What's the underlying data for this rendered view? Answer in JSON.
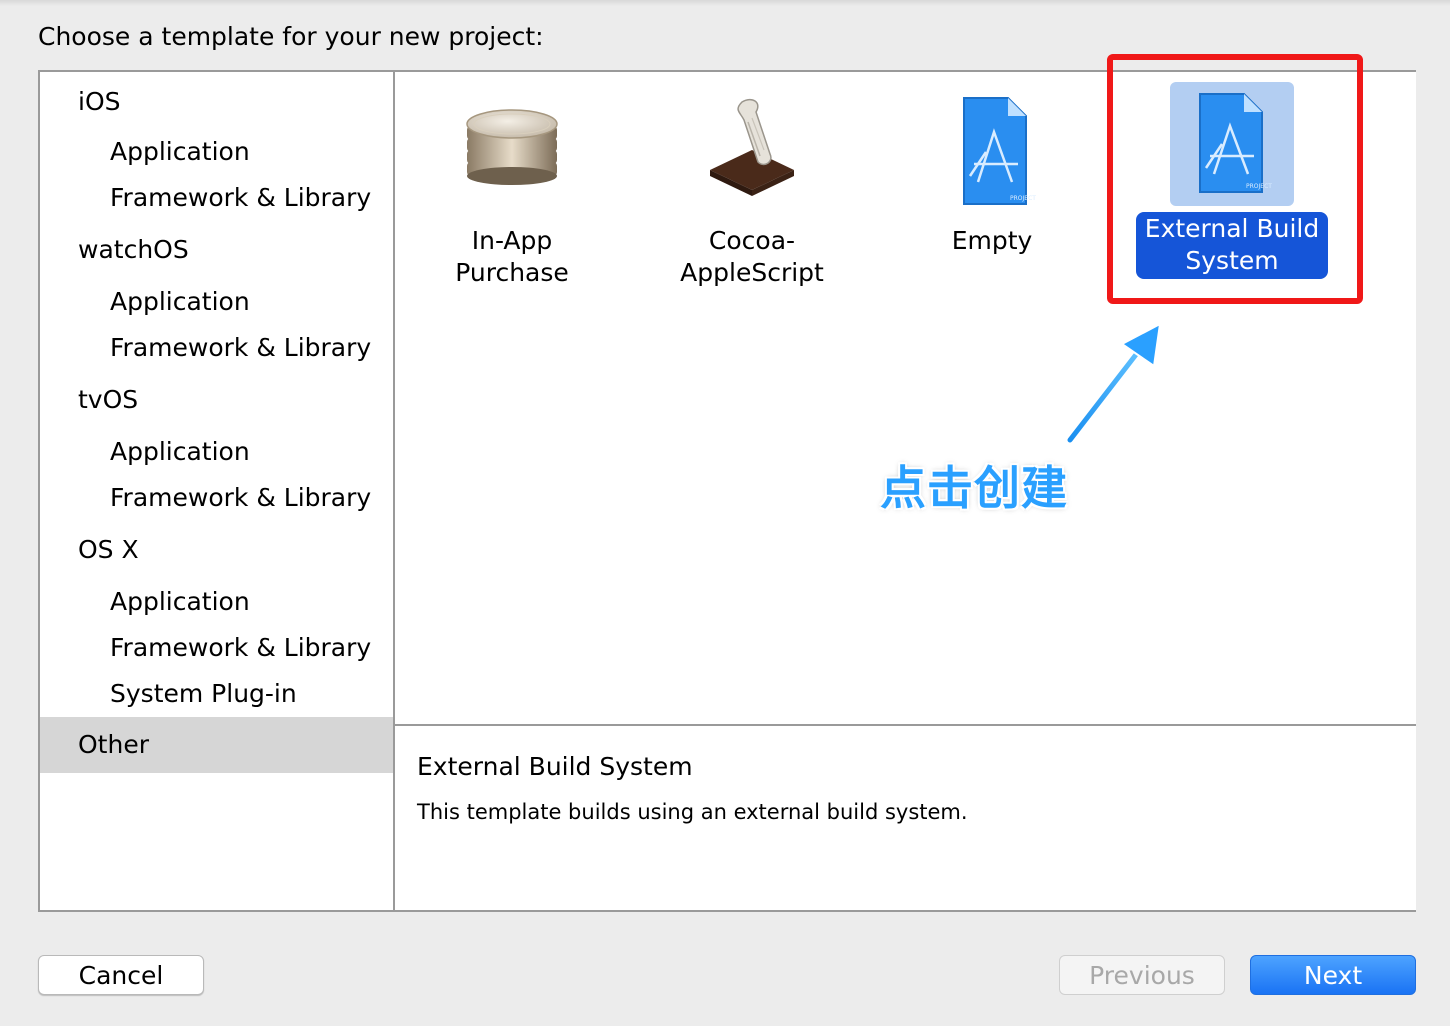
{
  "prompt": "Choose a template for your new project:",
  "sidebar": {
    "rows": [
      {
        "label": "iOS",
        "kind": "platform"
      },
      {
        "label": "Application",
        "kind": "category"
      },
      {
        "label": "Framework & Library",
        "kind": "category"
      },
      {
        "label": "watchOS",
        "kind": "platform"
      },
      {
        "label": "Application",
        "kind": "category"
      },
      {
        "label": "Framework & Library",
        "kind": "category"
      },
      {
        "label": "tvOS",
        "kind": "platform"
      },
      {
        "label": "Application",
        "kind": "category"
      },
      {
        "label": "Framework & Library",
        "kind": "category"
      },
      {
        "label": "OS X",
        "kind": "platform"
      },
      {
        "label": "Application",
        "kind": "category"
      },
      {
        "label": "Framework & Library",
        "kind": "category"
      },
      {
        "label": "System Plug-in",
        "kind": "category"
      },
      {
        "label": "Other",
        "kind": "platform",
        "selected": true
      }
    ]
  },
  "templates": [
    {
      "line1": "In-App",
      "line2": "Purchase",
      "icon": "coins-icon",
      "selected": false
    },
    {
      "line1": "Cocoa-",
      "line2": "AppleScript",
      "icon": "applescript-scroll-icon",
      "selected": false
    },
    {
      "line1": "Empty",
      "line2": "",
      "icon": "xcode-project-icon",
      "selected": false
    },
    {
      "line1": "External Build",
      "line2": "System",
      "icon": "xcode-project-icon",
      "selected": true
    }
  ],
  "description": {
    "title": "External Build System",
    "text": "This template builds using an external build system."
  },
  "annotation": {
    "text": "点击创建",
    "color": "#2aa0ff",
    "box_color": "#f01818"
  },
  "buttons": {
    "cancel": "Cancel",
    "previous": "Previous",
    "next": "Next"
  },
  "colors": {
    "selection_blue": "#1555d8",
    "accent_blue": "#1a73f4"
  }
}
